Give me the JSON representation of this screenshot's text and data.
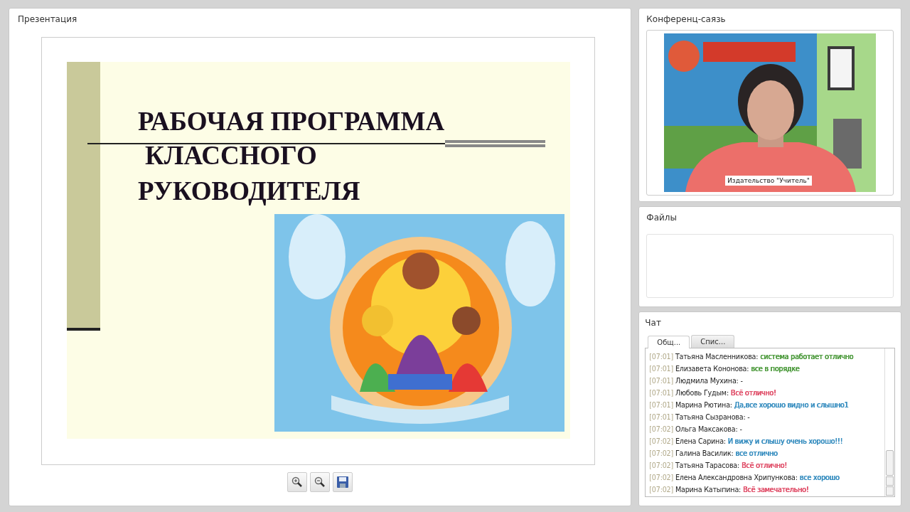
{
  "presentation": {
    "title": "Презентация",
    "slide": {
      "title_lines": [
        "РАБОЧАЯ ПРОГРАММА",
        "КЛАССНОГО",
        "РУКОВОДИТЕЛЯ"
      ]
    },
    "toolbar": [
      {
        "kind": "zoom-in"
      },
      {
        "kind": "zoom-out"
      },
      {
        "kind": "save"
      }
    ]
  },
  "conference": {
    "title": "Конференц-саязь",
    "caption": "Издательство \"Учитель\""
  },
  "files": {
    "title": "Файлы"
  },
  "chat": {
    "title": "Чат",
    "tabs": [
      {
        "label": "Общ...",
        "selected": true
      },
      {
        "label": "Спис...",
        "selected": false
      }
    ],
    "messages": [
      {
        "time": "[07:01]",
        "author": "Татьяна Масленникова:",
        "text": "система работает отлично",
        "color": "#4c9a3c"
      },
      {
        "time": "[07:01]",
        "author": "Елизавета Кононова:",
        "text": "все в порядке",
        "color": "#4c9a3c"
      },
      {
        "time": "[07:01]",
        "author": "Людмила Мухина:",
        "text": "-"
      },
      {
        "time": "[07:01]",
        "author": "Любовь Гудым:",
        "text": "Всё отлично!",
        "color": "#e0506a"
      },
      {
        "time": "[07:01]",
        "author": "Марина Рютина:",
        "text": "Да,все хорошо видно и слышно1",
        "color": "#3a8fc0"
      },
      {
        "time": "[07:01]",
        "author": "Татьяна Сызранова:",
        "text": "-"
      },
      {
        "time": "[07:02]",
        "author": "Ольга Максакова:",
        "text": "-"
      },
      {
        "time": "[07:02]",
        "author": "Елена Сарина:",
        "text": "И вижу и слышу очень хорошо!!!",
        "color": "#3a8fc0"
      },
      {
        "time": "[07:02]",
        "author": "Галина Василик:",
        "text": "все отлично",
        "color": "#3a8fc0"
      },
      {
        "time": "[07:02]",
        "author": "Татьяна Тарасова:",
        "text": "Всё отлично!",
        "color": "#e0506a"
      },
      {
        "time": "[07:02]",
        "author": "Елена Александровна Хрипункова:",
        "text": "все хорошо",
        "color": "#3a8fc0"
      },
      {
        "time": "[07:02]",
        "author": "Марина Катыпина:",
        "text": "Всё замечательно!",
        "color": "#e0506a"
      }
    ]
  }
}
